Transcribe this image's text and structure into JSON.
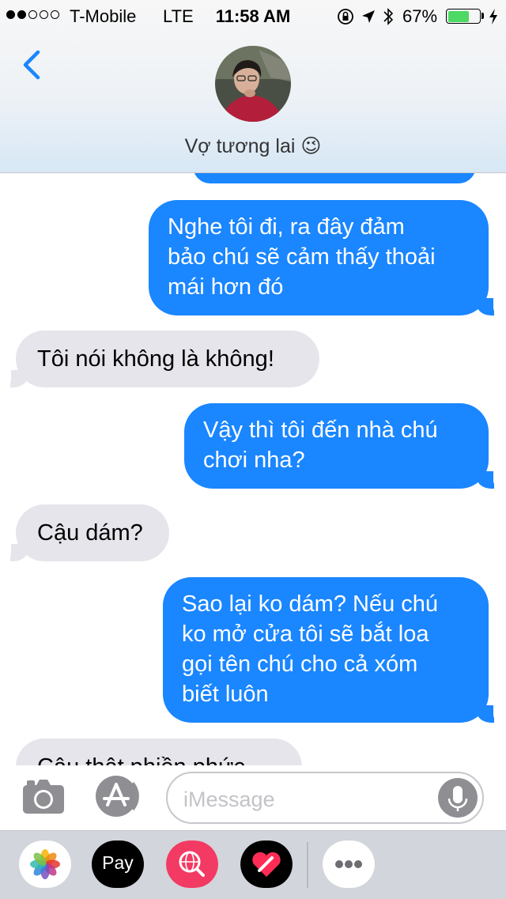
{
  "status_bar": {
    "carrier": "T-Mobile",
    "network": "LTE",
    "time": "11:58 AM",
    "battery_percent": "67%",
    "battery_level": 0.67,
    "signal_bars": 2,
    "icons": [
      "orientation-lock-icon",
      "location-arrow-icon",
      "bluetooth-icon",
      "charging-bolt-icon"
    ]
  },
  "header": {
    "back_icon": "chevron-left-icon",
    "contact_name": "Vợ tương lai 😉",
    "accent_color": "#1a86ff"
  },
  "messages": [
    {
      "direction": "outgoing",
      "lines": [
        "Nghe tôi đi, ra đây đảm",
        "bảo chú sẽ cảm thấy thoải",
        "mái hơn đó"
      ]
    },
    {
      "direction": "incoming",
      "lines": [
        "Tôi nói không là không!"
      ]
    },
    {
      "direction": "outgoing",
      "lines": [
        "Vậy thì tôi đến nhà chú",
        "chơi nha?"
      ]
    },
    {
      "direction": "incoming",
      "lines": [
        "Cậu dám?"
      ]
    },
    {
      "direction": "outgoing",
      "lines": [
        "Sao lại ko dám? Nếu chú",
        "ko mở cửa tôi sẽ bắt loa",
        "gọi tên chú cho cả xóm",
        "biết luôn"
      ]
    },
    {
      "direction": "incoming",
      "lines": [
        "Cậu thật phiền phức"
      ]
    }
  ],
  "input_bar": {
    "placeholder": "iMessage",
    "value": "",
    "camera_icon": "camera-icon",
    "apps_icon": "app-store-icon",
    "mic_icon": "microphone-icon"
  },
  "app_drawer": {
    "apps": [
      {
        "name": "photos-app-icon"
      },
      {
        "name": "apple-pay-app-icon",
        "label": "Pay"
      },
      {
        "name": "web-search-app-icon"
      },
      {
        "name": "digital-touch-app-icon"
      },
      {
        "name": "more-apps-icon"
      }
    ]
  },
  "colors": {
    "outgoing_bubble": "#1a86ff",
    "incoming_bubble": "#e6e5eb",
    "drawer_background": "#d2d5db"
  }
}
